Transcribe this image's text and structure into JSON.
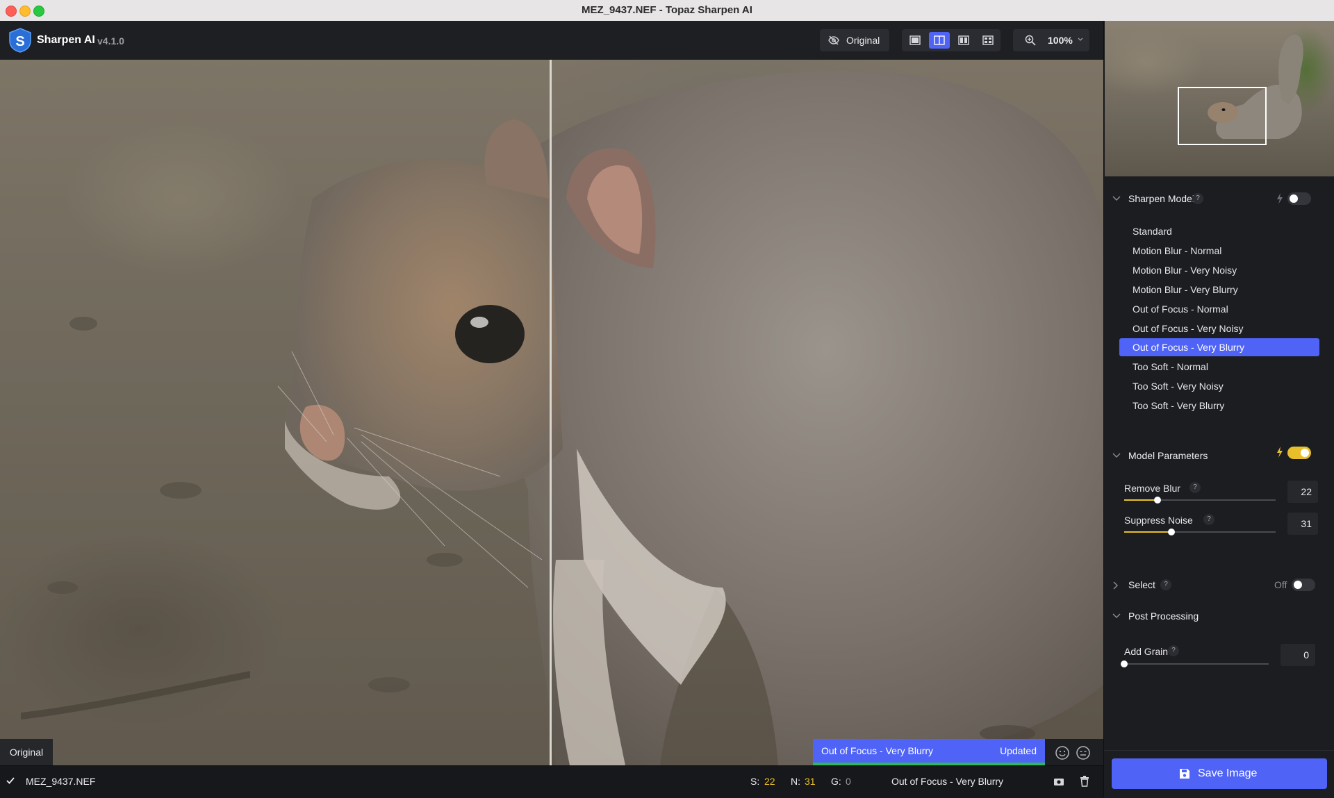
{
  "window": {
    "title": "MEZ_9437.NEF - Topaz Sharpen AI"
  },
  "app": {
    "name": "Sharpen AI",
    "version": "v4.1.0"
  },
  "toolbar": {
    "original_label": "Original",
    "zoom_level": "100%",
    "view_modes": [
      "single",
      "split",
      "side-by-side",
      "quad"
    ],
    "active_view_mode": "split"
  },
  "preview": {
    "original_tag": "Original",
    "status_model": "Out of Focus - Very Blurry",
    "status_text": "Updated"
  },
  "bottombar": {
    "filename": "MEZ_9437.NEF",
    "s_label": "S:",
    "s_value": "22",
    "n_label": "N:",
    "n_value": "31",
    "g_label": "G:",
    "g_value": "0",
    "model": "Out of Focus - Very Blurry"
  },
  "panel": {
    "sharpen_model": {
      "title": "Sharpen Model",
      "help": "?",
      "auto_toggle_on": false,
      "selected_index": 6,
      "models": [
        "Standard",
        "Motion Blur - Normal",
        "Motion Blur - Very Noisy",
        "Motion Blur - Very Blurry",
        "Out of Focus - Normal",
        "Out of Focus - Very Noisy",
        "Out of Focus - Very Blurry",
        "Too Soft - Normal",
        "Too Soft - Very Noisy",
        "Too Soft - Very Blurry"
      ]
    },
    "model_parameters": {
      "title": "Model Parameters",
      "auto_toggle_on": true,
      "remove_blur": {
        "label": "Remove Blur",
        "help": "?",
        "value": "22",
        "fraction": 0.22
      },
      "suppress_noise": {
        "label": "Suppress Noise",
        "help": "?",
        "value": "31",
        "fraction": 0.31
      }
    },
    "select": {
      "title": "Select",
      "help": "?",
      "state": "Off"
    },
    "post_processing": {
      "title": "Post Processing",
      "add_grain": {
        "label": "Add Grain",
        "help": "?",
        "value": "0",
        "fraction": 0
      }
    },
    "save_label": "Save Image"
  },
  "colors": {
    "accent": "#4f63f7",
    "toggle_on": "#e8bf2a",
    "updated_bar": "#2fb85a"
  }
}
